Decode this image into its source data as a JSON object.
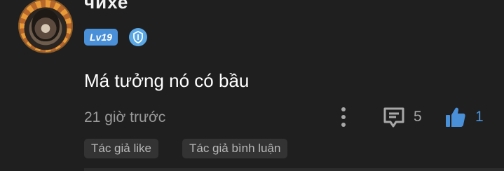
{
  "comment": {
    "username": "чихе",
    "level": "Lv19",
    "text": "Má tưởng nó có bầu",
    "timestamp": "21 giờ trước",
    "reply_count": "5",
    "like_count": "1",
    "tags": [
      "Tác giả like",
      "Tác giả bình luận"
    ]
  },
  "colors": {
    "background": "#1f1f1f",
    "accent": "#4a90d9",
    "muted_text": "#9a9a9a",
    "tag_bg": "#333333"
  },
  "icons": {
    "rank": "shield-icon",
    "more": "more-vertical-icon",
    "reply": "comment-icon",
    "like": "thumbs-up-icon"
  }
}
